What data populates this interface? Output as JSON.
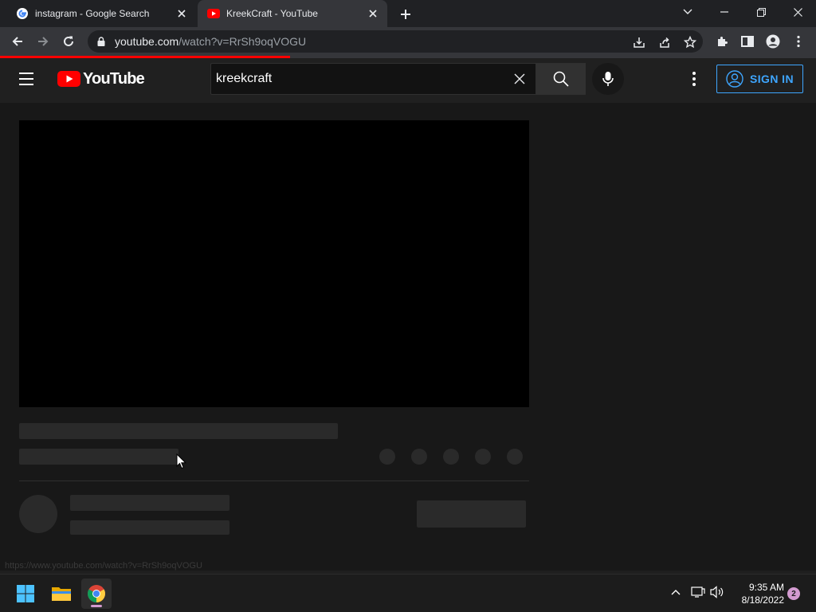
{
  "browser": {
    "tabs": [
      {
        "title": "instagram - Google Search",
        "favicon": "google-icon",
        "active": false
      },
      {
        "title": "KreekCraft - YouTube",
        "favicon": "youtube-icon",
        "active": true
      }
    ],
    "address": {
      "domain": "youtube.com",
      "path": "/watch?v=RrSh9oqVOGU"
    },
    "load_progress": 0.355
  },
  "youtube": {
    "logo_text": "YouTube",
    "search_value": "kreekcraft",
    "signin_label": "SIGN IN",
    "status_url": "https://www.youtube.com/watch?v=RrSh9oqVOGU"
  },
  "taskbar": {
    "time": "9:35 AM",
    "date": "8/18/2022",
    "notification_count": "2"
  },
  "colors": {
    "yt_red": "#ff0000",
    "signin_blue": "#3ea6ff",
    "notif_badge": "#d39bd0"
  }
}
